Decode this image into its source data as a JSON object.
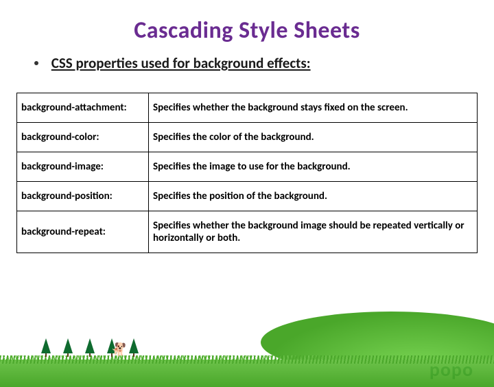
{
  "title": "Cascading Style Sheets",
  "subtitle": "CSS properties used for background effects:",
  "table": {
    "rows": [
      {
        "prop": "background-attachment:",
        "desc": "Specifies whether the background stays fixed on the screen."
      },
      {
        "prop": "background-color:",
        "desc": "Specifies the color of the background."
      },
      {
        "prop": "background-image:",
        "desc": "Specifies the image to use for the background."
      },
      {
        "prop": "background-position:",
        "desc": "Specifies the position of the background."
      },
      {
        "prop": "background-repeat:",
        "desc": "Specifies whether the background image should be repeated vertically or horizontally or both."
      }
    ]
  },
  "watermark": "popo"
}
